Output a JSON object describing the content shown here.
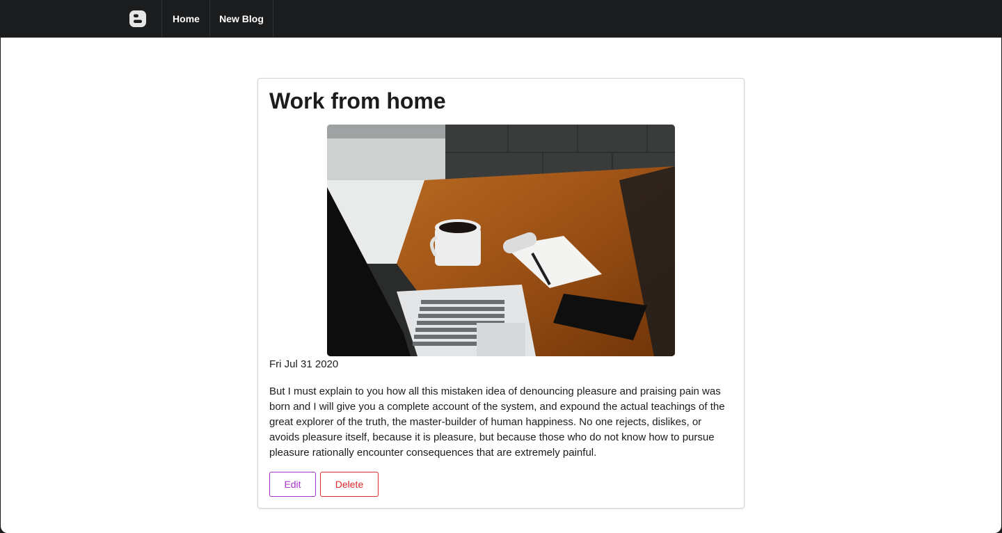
{
  "nav": {
    "logo_icon": "blogger-logo-icon",
    "home_label": "Home",
    "new_blog_label": "New Blog"
  },
  "post": {
    "title": "Work from home",
    "image_alt": "laptop-coffee-desk-photo",
    "date": "Fri Jul 31 2020",
    "body": "But I must explain to you how all this mistaken idea of denouncing pleasure and praising pain was born and I will give you a complete account of the system, and expound the actual teachings of the great explorer of the truth, the master-builder of human happiness. No one rejects, dislikes, or avoids pleasure itself, because it is pleasure, but because those who do not know how to pursue pleasure rationally encounter consequences that are extremely painful.",
    "edit_label": "Edit",
    "delete_label": "Delete"
  },
  "colors": {
    "navbar": "#1b1c1d",
    "edit": "#a333c8",
    "delete": "#db2828"
  }
}
